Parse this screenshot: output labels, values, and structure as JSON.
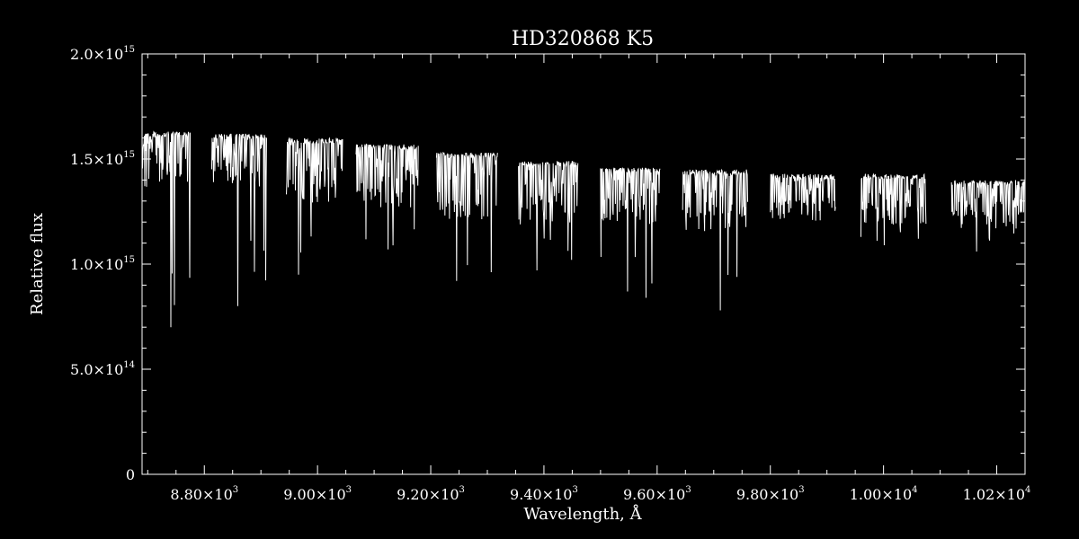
{
  "colors": {
    "background": "#000000",
    "foreground": "#ffffff"
  },
  "chart_data": {
    "type": "line",
    "title": "HD320868  K5",
    "xlabel": "Wavelength, Å",
    "ylabel": "Relative flux",
    "xlim": [
      8690,
      10250
    ],
    "ylim": [
      0,
      2000000000000000.0
    ],
    "grid": false,
    "x_ticks": [
      {
        "value": 8800,
        "mantissa": "8.80",
        "exp": "3"
      },
      {
        "value": 9000,
        "mantissa": "9.00",
        "exp": "3"
      },
      {
        "value": 9200,
        "mantissa": "9.20",
        "exp": "3"
      },
      {
        "value": 9400,
        "mantissa": "9.40",
        "exp": "3"
      },
      {
        "value": 9600,
        "mantissa": "9.60",
        "exp": "3"
      },
      {
        "value": 9800,
        "mantissa": "9.80",
        "exp": "3"
      },
      {
        "value": 10000,
        "mantissa": "1.00",
        "exp": "4"
      },
      {
        "value": 10200,
        "mantissa": "1.02",
        "exp": "4"
      }
    ],
    "y_ticks": [
      {
        "value": 0,
        "mantissa": "0",
        "exp": ""
      },
      {
        "value": 500000000000000.0,
        "mantissa": "5.0",
        "exp": "14"
      },
      {
        "value": 1000000000000000.0,
        "mantissa": "1.0",
        "exp": "15"
      },
      {
        "value": 1500000000000000.0,
        "mantissa": "1.5",
        "exp": "15"
      },
      {
        "value": 2000000000000000.0,
        "mantissa": "2.0",
        "exp": "15"
      }
    ],
    "series": [
      {
        "segments": [
          {
            "x0": 8690,
            "x1": 8775,
            "top": 1630000000000000.0,
            "base": 1450000000000000.0,
            "min": 700000000000000.0
          },
          {
            "x0": 8813,
            "x1": 8910,
            "top": 1620000000000000.0,
            "base": 1460000000000000.0,
            "min": 800000000000000.0
          },
          {
            "x0": 8945,
            "x1": 9045,
            "top": 1600000000000000.0,
            "base": 1380000000000000.0,
            "min": 950000000000000.0
          },
          {
            "x0": 9068,
            "x1": 9178,
            "top": 1570000000000000.0,
            "base": 1350000000000000.0,
            "min": 1070000000000000.0
          },
          {
            "x0": 9210,
            "x1": 9318,
            "top": 1530000000000000.0,
            "base": 1300000000000000.0,
            "min": 920000000000000.0
          },
          {
            "x0": 9355,
            "x1": 9460,
            "top": 1490000000000000.0,
            "base": 1280000000000000.0,
            "min": 970000000000000.0
          },
          {
            "x0": 9500,
            "x1": 9605,
            "top": 1460000000000000.0,
            "base": 1280000000000000.0,
            "min": 840000000000000.0
          },
          {
            "x0": 9645,
            "x1": 9760,
            "top": 1450000000000000.0,
            "base": 1250000000000000.0,
            "min": 780000000000000.0
          },
          {
            "x0": 9800,
            "x1": 9915,
            "top": 1430000000000000.0,
            "base": 1300000000000000.0,
            "min": 1210000000000000.0
          },
          {
            "x0": 9960,
            "x1": 10075,
            "top": 1430000000000000.0,
            "base": 1280000000000000.0,
            "min": 1090000000000000.0
          },
          {
            "x0": 10120,
            "x1": 10250,
            "top": 1400000000000000.0,
            "base": 1250000000000000.0,
            "min": 1060000000000000.0
          }
        ]
      }
    ]
  }
}
